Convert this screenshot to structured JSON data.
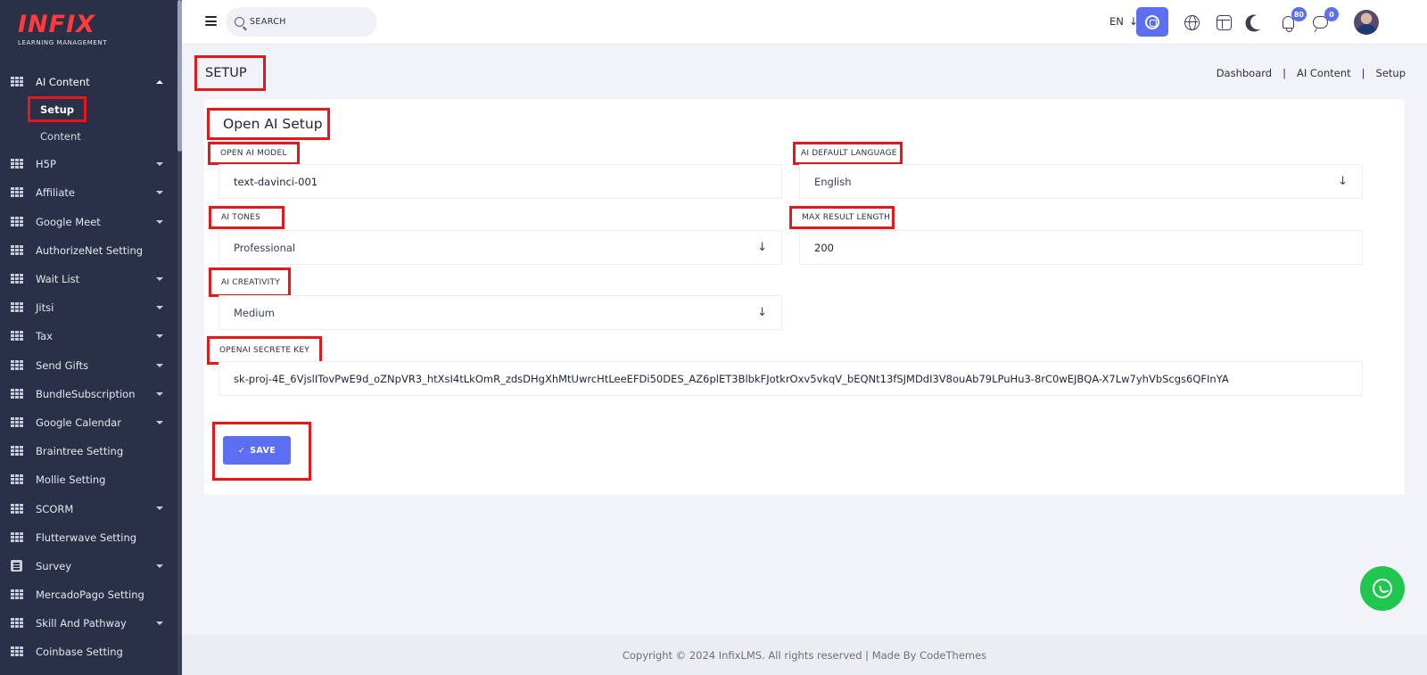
{
  "sidebar": {
    "logo_word": "INFIX",
    "logo_tagline": "LEARNING MANAGEMENT",
    "section": {
      "label": "AI Content",
      "expanded": true
    },
    "sub_items": [
      {
        "label": "Setup",
        "active": true
      },
      {
        "label": "Content",
        "active": false
      }
    ],
    "items": [
      {
        "label": "H5P",
        "caret": true,
        "icon": "grid-icon"
      },
      {
        "label": "Affiliate",
        "caret": true,
        "icon": "grid-icon"
      },
      {
        "label": "Google Meet",
        "caret": true,
        "icon": "grid-icon"
      },
      {
        "label": "AuthorizeNet Setting",
        "caret": false,
        "icon": "grid-icon"
      },
      {
        "label": "Wait List",
        "caret": true,
        "icon": "grid-icon"
      },
      {
        "label": "Jitsi",
        "caret": true,
        "icon": "grid-icon"
      },
      {
        "label": "Tax",
        "caret": true,
        "icon": "grid-icon"
      },
      {
        "label": "Send Gifts",
        "caret": true,
        "icon": "grid-icon"
      },
      {
        "label": "BundleSubscription",
        "caret": true,
        "icon": "grid-icon"
      },
      {
        "label": "Google Calendar",
        "caret": true,
        "icon": "grid-icon"
      },
      {
        "label": "Braintree Setting",
        "caret": false,
        "icon": "grid-icon"
      },
      {
        "label": "Mollie Setting",
        "caret": false,
        "icon": "grid-icon"
      },
      {
        "label": "SCORM",
        "caret": true,
        "icon": "grid-icon"
      },
      {
        "label": "Flutterwave Setting",
        "caret": false,
        "icon": "grid-icon"
      },
      {
        "label": "Survey",
        "caret": true,
        "icon": "document-icon"
      },
      {
        "label": "MercadoPago Setting",
        "caret": false,
        "icon": "grid-icon"
      },
      {
        "label": "Skill And Pathway",
        "caret": true,
        "icon": "grid-icon"
      },
      {
        "label": "Coinbase Setting",
        "caret": false,
        "icon": "grid-icon"
      }
    ]
  },
  "header": {
    "search_placeholder": "SEARCH",
    "language": "EN",
    "notification_count": "80",
    "message_count": "0",
    "accent_color": "#5c6ff2"
  },
  "page": {
    "title": "SETUP",
    "breadcrumb": [
      "Dashboard",
      "AI Content",
      "Setup"
    ]
  },
  "form": {
    "title": "Open AI Setup",
    "model_label": "OPEN AI MODEL",
    "model_value": "text-davinci-001",
    "language_label": "AI DEFAULT LANGUAGE",
    "language_value": "English",
    "tones_label": "AI TONES",
    "tones_value": "Professional",
    "max_length_label": "MAX RESULT LENGTH",
    "max_length_value": "200",
    "creativity_label": "AI CREATIVITY",
    "creativity_value": "Medium",
    "secret_key_label": "OPENAI SECRETE KEY",
    "secret_key_value": "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",
    "save_label": "SAVE"
  },
  "footer": {
    "copyright": "Copyright © 2024 InfixLMS. All rights reserved | Made By CodeThemes"
  }
}
